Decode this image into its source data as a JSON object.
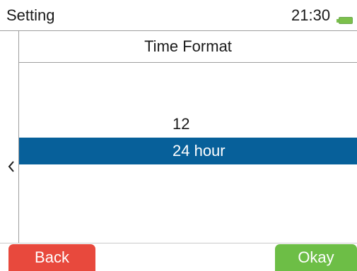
{
  "status_bar": {
    "title": "Setting",
    "time": "21:30",
    "battery_icon": "battery-icon",
    "battery_color": "#7cc04b"
  },
  "nav": {
    "back_icon": "chevron-left-icon"
  },
  "screen": {
    "title": "Time Format"
  },
  "picker": {
    "options": [
      "12",
      "24 hour"
    ],
    "selected": "24 hour",
    "selected_color": "#07609a"
  },
  "footer": {
    "back_label": "Back",
    "back_color": "#e8493d",
    "okay_label": "Okay",
    "okay_color": "#6dbe46"
  }
}
